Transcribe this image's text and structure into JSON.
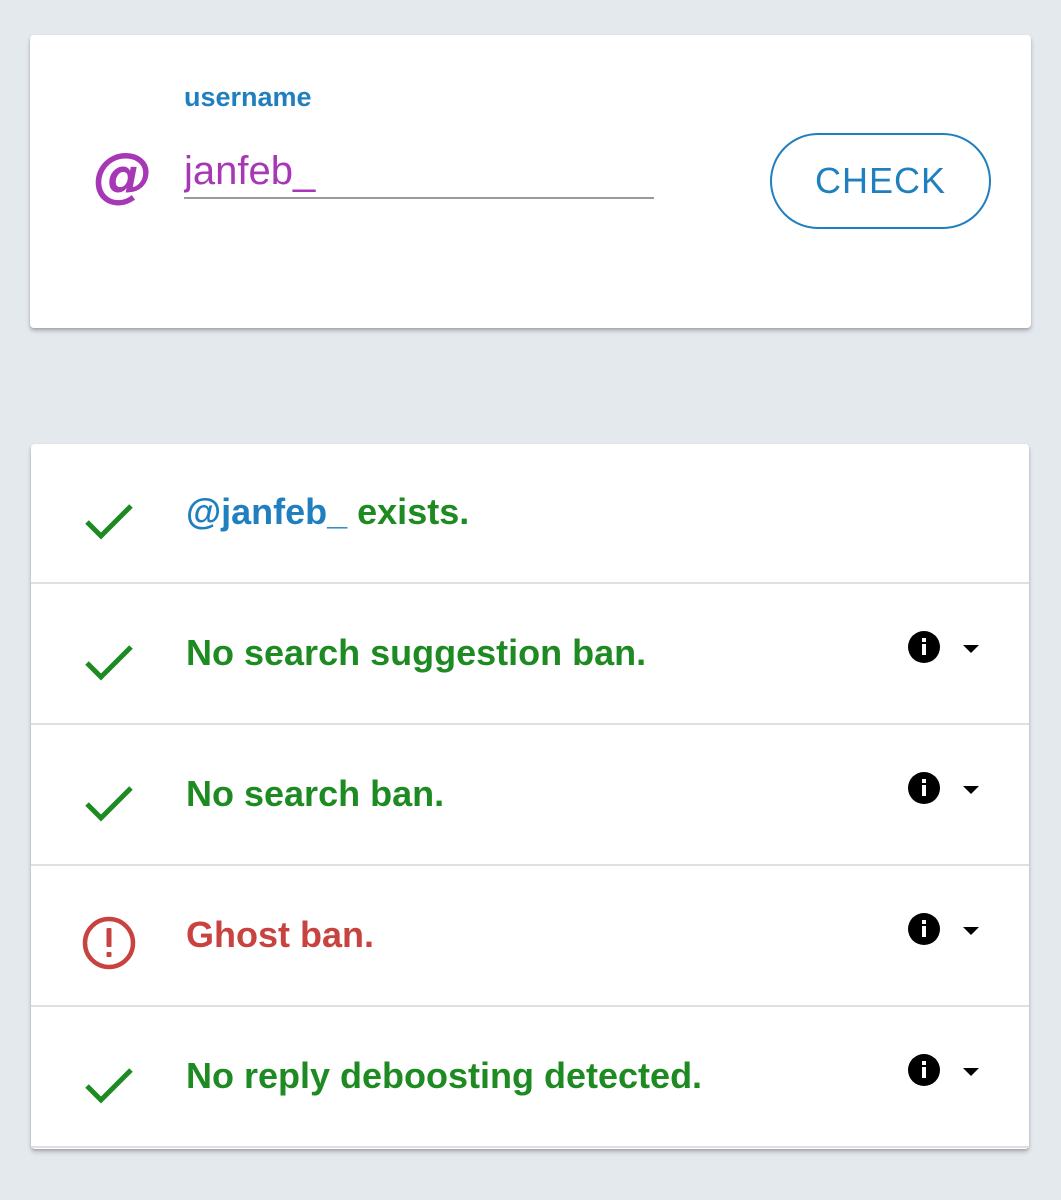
{
  "search": {
    "label": "username",
    "value": "janfeb_",
    "at_symbol": "@",
    "button_label": "CHECK"
  },
  "results": {
    "exists": {
      "handle": "@janfeb_",
      "suffix": " exists.",
      "status": "ok",
      "icon": "check-icon"
    },
    "items": [
      {
        "text": "No search suggestion ban.",
        "status": "ok",
        "icon": "check-icon"
      },
      {
        "text": "No search ban.",
        "status": "ok",
        "icon": "check-icon"
      },
      {
        "text": "Ghost ban.",
        "status": "bad",
        "icon": "alert-circle-icon"
      },
      {
        "text": "No reply deboosting detected.",
        "status": "ok",
        "icon": "check-icon"
      }
    ]
  },
  "colors": {
    "background": "#e4e9ee",
    "accent_blue": "#1f7fbf",
    "username_purple": "#a637b5",
    "ok_green": "#1e8a22",
    "error_red": "#c8423f"
  }
}
